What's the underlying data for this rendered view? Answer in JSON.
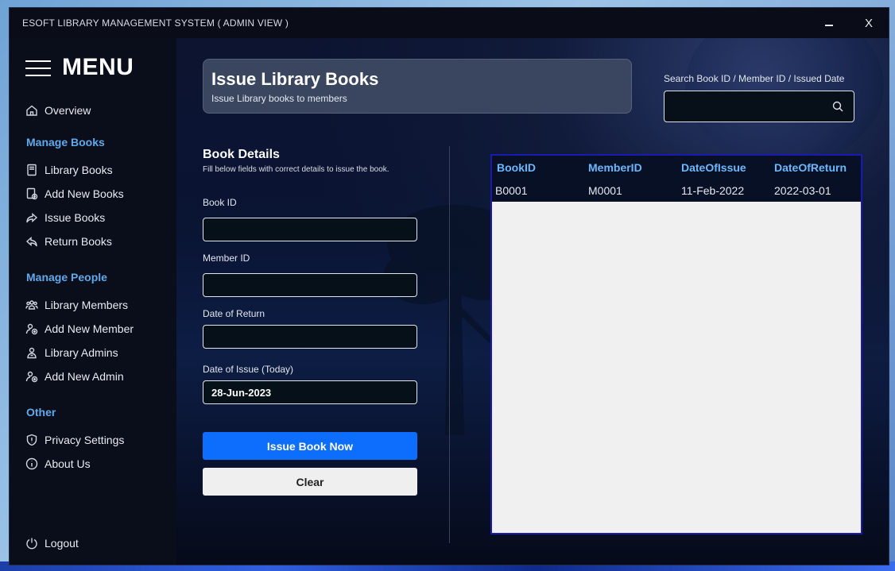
{
  "window": {
    "title": "ESOFT LIBRARY MANAGEMENT SYSTEM ( ADMIN VIEW )",
    "close_label": "X"
  },
  "sidebar": {
    "menu_title": "MENU",
    "overview": "Overview",
    "sections": {
      "books": "Manage Books",
      "people": "Manage People",
      "other": "Other"
    },
    "items": {
      "library_books": "Library Books",
      "add_new_books": "Add New Books",
      "issue_books": "Issue Books",
      "return_books": "Return Books",
      "library_members": "Library Members",
      "add_new_member": "Add New Member",
      "library_admins": "Library Admins",
      "add_new_admin": "Add New Admin",
      "privacy_settings": "Privacy Settings",
      "about_us": "About Us"
    },
    "logout": "Logout"
  },
  "header": {
    "title": "Issue Library Books",
    "subtitle": "Issue Library books to members"
  },
  "search": {
    "label": "Search Book ID / Member ID / Issued Date",
    "value": ""
  },
  "form": {
    "title": "Book Details",
    "subtitle": "Fill below fields with correct details to issue the book.",
    "book_id_label": "Book ID",
    "book_id_value": "",
    "member_id_label": "Member ID",
    "member_id_value": "",
    "return_date_label": "Date of Return",
    "return_date_value": "",
    "issue_date_label": "Date of Issue (Today)",
    "issue_date_value": "28-Jun-2023",
    "issue_button": "Issue Book Now",
    "clear_button": "Clear"
  },
  "table": {
    "headers": [
      "BookID",
      "MemberID",
      "DateOfIssue",
      "DateOfReturn"
    ],
    "rows": [
      [
        "B0001",
        "M0001",
        "11-Feb-2022",
        "2022-03-01"
      ]
    ]
  },
  "colors": {
    "accent": "#0d6efd",
    "section_title": "#5fa9ec",
    "table_header": "#6ab8ff"
  }
}
